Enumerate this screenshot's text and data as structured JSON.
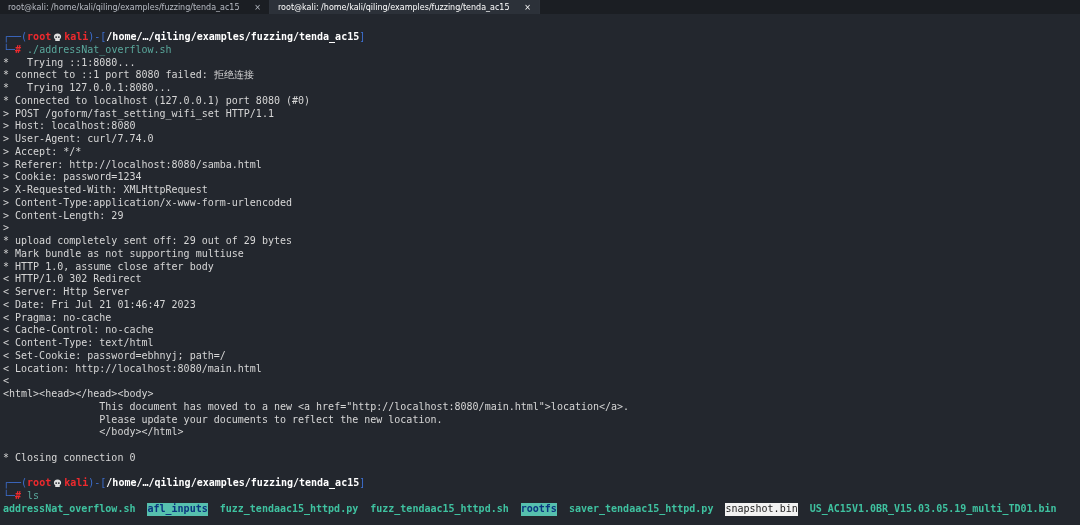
{
  "tabs": [
    {
      "title": "root@kali: /home/kali/qiling/examples/fuzzing/tenda_ac15",
      "close": "×",
      "selected": false
    },
    {
      "title": "root@kali: /home/kali/qiling/examples/fuzzing/tenda_ac15",
      "close": "×",
      "selected": true
    }
  ],
  "blocks": [
    {
      "kind": "prompt",
      "frame_open": "┌──(",
      "user": "root",
      "host": "kali",
      "frame_mid": ")-[",
      "path": "/home/…/qiling/examples/fuzzing/tenda_ac15",
      "frame_close": "]",
      "frame_lower": "└─",
      "symbol": "#",
      "command": "./addressNat_overflow.sh"
    },
    {
      "kind": "output",
      "lines": [
        {
          "kind": "text",
          "text": "*   Trying ::1:8080...",
          "indent": false
        },
        {
          "kind": "text",
          "text": "* connect to ::1 port 8080 failed: 拒绝连接",
          "indent": false
        },
        {
          "kind": "text",
          "text": "*   Trying 127.0.0.1:8080...",
          "indent": false
        },
        {
          "kind": "text",
          "text": "* Connected to localhost (127.0.0.1) port 8080 (#0)",
          "indent": false
        },
        {
          "kind": "text",
          "text": "> POST /goform/fast_setting_wifi_set HTTP/1.1",
          "indent": false
        },
        {
          "kind": "text",
          "text": "> Host: localhost:8080",
          "indent": false
        },
        {
          "kind": "text",
          "text": "> User-Agent: curl/7.74.0",
          "indent": false
        },
        {
          "kind": "text",
          "text": "> Accept: */*",
          "indent": false
        },
        {
          "kind": "text",
          "text": "> Referer: http://localhost:8080/samba.html",
          "indent": false
        },
        {
          "kind": "text",
          "text": "> Cookie: password=1234",
          "indent": false
        },
        {
          "kind": "text",
          "text": "> X-Requested-With: XMLHttpRequest",
          "indent": false
        },
        {
          "kind": "text",
          "text": "> Content-Type:application/x-www-form-urlencoded",
          "indent": false
        },
        {
          "kind": "text",
          "text": "> Content-Length: 29",
          "indent": false
        },
        {
          "kind": "text",
          "text": ">",
          "indent": false
        },
        {
          "kind": "text",
          "text": "* upload completely sent off: 29 out of 29 bytes",
          "indent": false
        },
        {
          "kind": "text",
          "text": "* Mark bundle as not supporting multiuse",
          "indent": false
        },
        {
          "kind": "text",
          "text": "* HTTP 1.0, assume close after body",
          "indent": false
        },
        {
          "kind": "text",
          "text": "< HTTP/1.0 302 Redirect",
          "indent": false
        },
        {
          "kind": "text",
          "text": "< Server: Http Server",
          "indent": false
        },
        {
          "kind": "text",
          "text": "< Date: Fri Jul 21 01:46:47 2023",
          "indent": false
        },
        {
          "kind": "text",
          "text": "< Pragma: no-cache",
          "indent": false
        },
        {
          "kind": "text",
          "text": "< Cache-Control: no-cache",
          "indent": false
        },
        {
          "kind": "text",
          "text": "< Content-Type: text/html",
          "indent": false
        },
        {
          "kind": "text",
          "text": "< Set-Cookie: password=ebhnyj; path=/",
          "indent": false
        },
        {
          "kind": "text",
          "text": "< Location: http://localhost:8080/main.html",
          "indent": false
        },
        {
          "kind": "text",
          "text": "<",
          "indent": false
        },
        {
          "kind": "text",
          "text": "<html><head></head><body>",
          "indent": false
        },
        {
          "kind": "text",
          "text": "This document has moved to a new <a href=\"http://localhost:8080/main.html\">location</a>.",
          "indent": true
        },
        {
          "kind": "text",
          "text": "Please update your documents to reflect the new location.",
          "indent": true
        },
        {
          "kind": "text",
          "text": "</body></html>",
          "indent": true
        },
        {
          "kind": "blank"
        },
        {
          "kind": "text",
          "text": "* Closing connection 0",
          "indent": false
        },
        {
          "kind": "blank"
        }
      ]
    },
    {
      "kind": "prompt",
      "frame_open": "┌──(",
      "user": "root",
      "host": "kali",
      "frame_mid": ")-[",
      "path": "/home/…/qiling/examples/fuzzing/tenda_ac15",
      "frame_close": "]",
      "frame_lower": "└─",
      "symbol": "#",
      "command": "ls"
    },
    {
      "kind": "listing",
      "entries": [
        {
          "name": "addressNat_overflow.sh",
          "kind": "exec"
        },
        {
          "name": "afl_inputs",
          "kind": "shared_dir"
        },
        {
          "name": "fuzz_tendaac15_httpd.py",
          "kind": "exec"
        },
        {
          "name": "fuzz_tendaac15_httpd.sh",
          "kind": "exec"
        },
        {
          "name": "rootfs",
          "kind": "shared_dir"
        },
        {
          "name": "saver_tendaac15_httpd.py",
          "kind": "exec"
        },
        {
          "name": "snapshot.bin",
          "kind": "highlight"
        },
        {
          "name": "US_AC15V1.0BR_V15.03.05.19_multi_TD01.bin",
          "kind": "exec"
        }
      ]
    }
  ]
}
